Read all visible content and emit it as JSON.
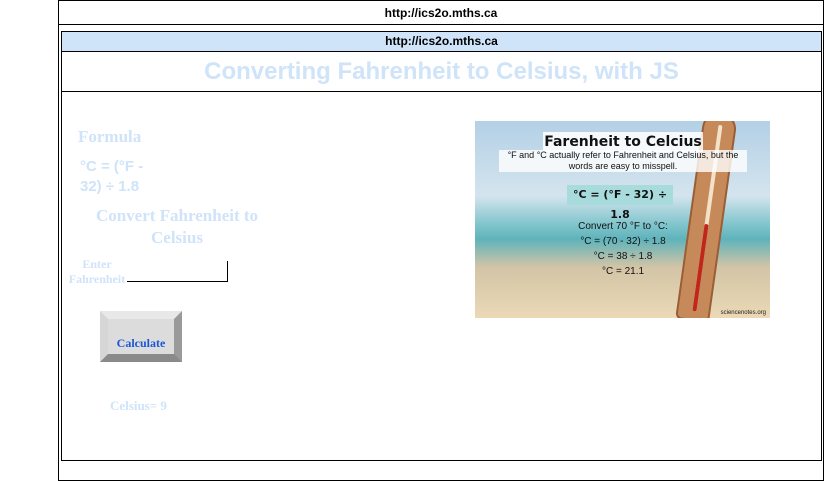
{
  "browser": {
    "outer_url": "http://ics2o.mths.ca",
    "inner_url": "http://ics2o.mths.ca"
  },
  "page": {
    "title": "Converting Fahrenheit to Celsius, with JS",
    "formula_heading": "Formula",
    "formula_line1": "°C = (°F -",
    "formula_line2": "32) ÷ 1.8",
    "convert_heading": "Convert Fahrenheit to Celsius",
    "input_label_line1": "Enter",
    "input_label_line2": "Fahrenheit",
    "input_value": "",
    "calculate_label": "Calculate",
    "result_text": "Celsius= 9"
  },
  "image_card": {
    "title": "Farenheit to Celcius",
    "subtitle": "°F and °C actually refer to Fahrenheit and Celsius, but the words are easy to misspell.",
    "formula": "°C = (°F - 32) ÷ 1.8",
    "example_line1": "Convert 70 °F to °C:",
    "example_line2": "°C = (70 - 32) ÷ 1.8",
    "example_line3": "°C = 38 ÷ 1.8",
    "example_line4": "°C = 21.1",
    "credit": "sciencenotes.org"
  },
  "colors": {
    "heading_pale_blue": "#cfe3f9",
    "url_bar_blue": "#cfe3f9",
    "button_text_blue": "#1a56d6"
  }
}
